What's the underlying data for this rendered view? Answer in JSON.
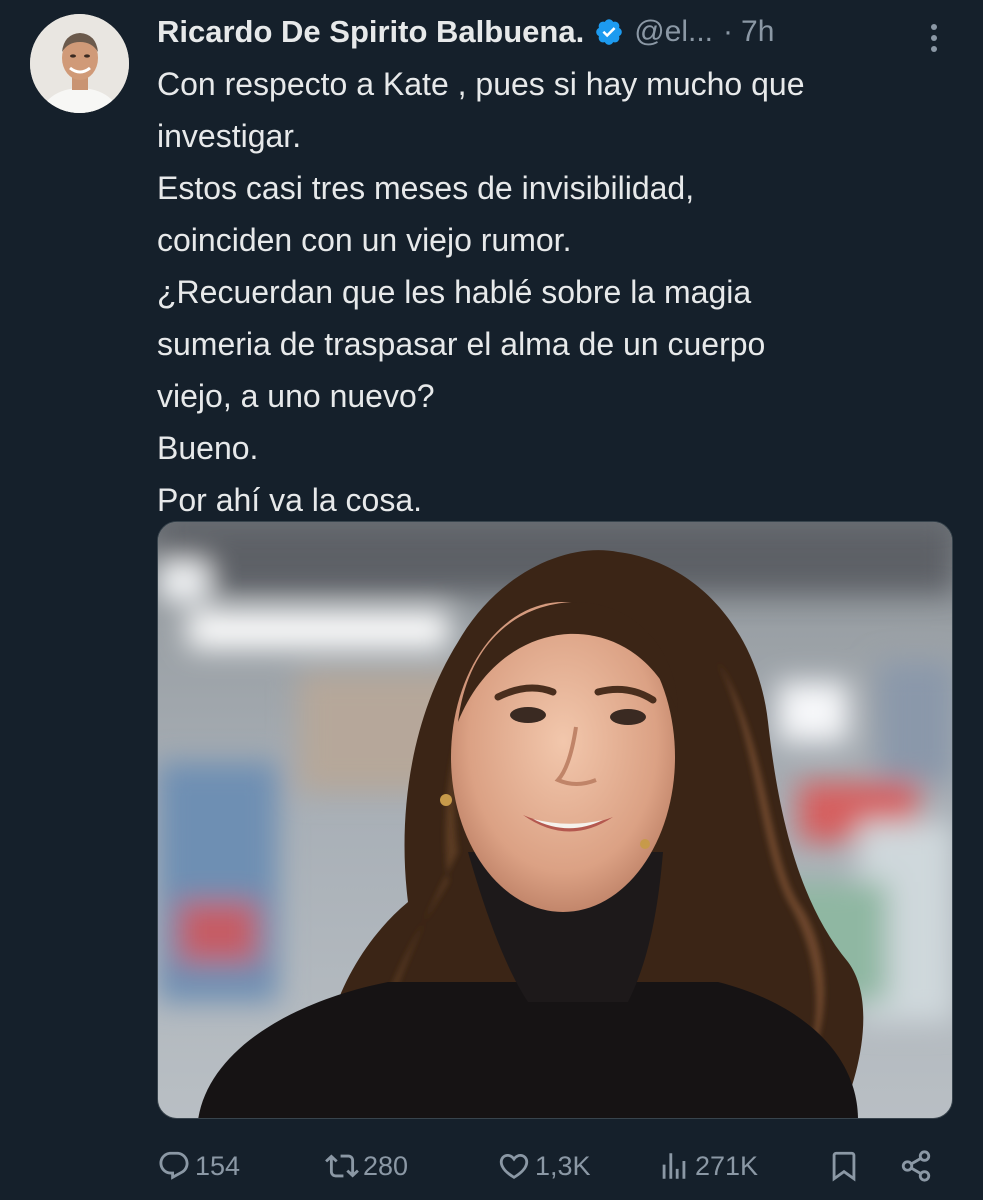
{
  "author": {
    "display_name": "Ricardo De Spirito Balbuena.",
    "handle": "@el...",
    "separator": "·",
    "time": "7h"
  },
  "tweet": {
    "lines": [
      "Con respecto a Kate , pues si hay mucho que",
      "investigar.",
      "Estos casi tres meses de invisibilidad,",
      "coinciden con un viejo rumor.",
      "¿Recuerdan que les hablé sobre la magia",
      "sumeria de traspasar el alma de un cuerpo",
      "viejo, a uno nuevo?",
      "Bueno.",
      "Por ahí va la cosa."
    ]
  },
  "stats": {
    "replies": "154",
    "retweets": "280",
    "likes": "1,3K",
    "views": "271K"
  },
  "icons": {
    "verified": "verified-badge-icon",
    "more": "more-vertical-icon",
    "reply": "comment-icon",
    "retweet": "retweet-icon",
    "like": "heart-icon",
    "views": "bar-chart-icon",
    "bookmark": "bookmark-icon",
    "share": "share-icon"
  },
  "colors": {
    "background": "#15202b",
    "text": "#e7e9ea",
    "secondary": "#8b98a5",
    "verified": "#1d9bf0"
  }
}
